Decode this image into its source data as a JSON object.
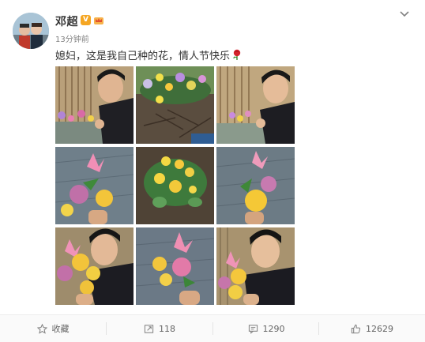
{
  "post": {
    "author": "邓超",
    "time": "13分钟前",
    "text": "媳妇，这是我自己种的花，情人节快乐",
    "verified_badge": "V",
    "colors": {
      "accent": "#f5a623",
      "name": "#333333",
      "meta": "#808080"
    }
  },
  "photos": [
    {
      "name": "photo-selfie-fence-1"
    },
    {
      "name": "photo-flowerbed-1"
    },
    {
      "name": "photo-selfie-fence-2"
    },
    {
      "name": "photo-bouquet-1"
    },
    {
      "name": "photo-flowerbed-2"
    },
    {
      "name": "photo-bouquet-2"
    },
    {
      "name": "photo-selfie-bouquet-1"
    },
    {
      "name": "photo-bouquet-3"
    },
    {
      "name": "photo-selfie-bouquet-2"
    }
  ],
  "actions": {
    "favorite": {
      "label": "收藏",
      "icon": "star-icon"
    },
    "repost": {
      "count": "118",
      "icon": "repost-icon"
    },
    "comment": {
      "count": "1290",
      "icon": "comment-icon"
    },
    "like": {
      "count": "12629",
      "icon": "thumbs-up-icon"
    }
  }
}
